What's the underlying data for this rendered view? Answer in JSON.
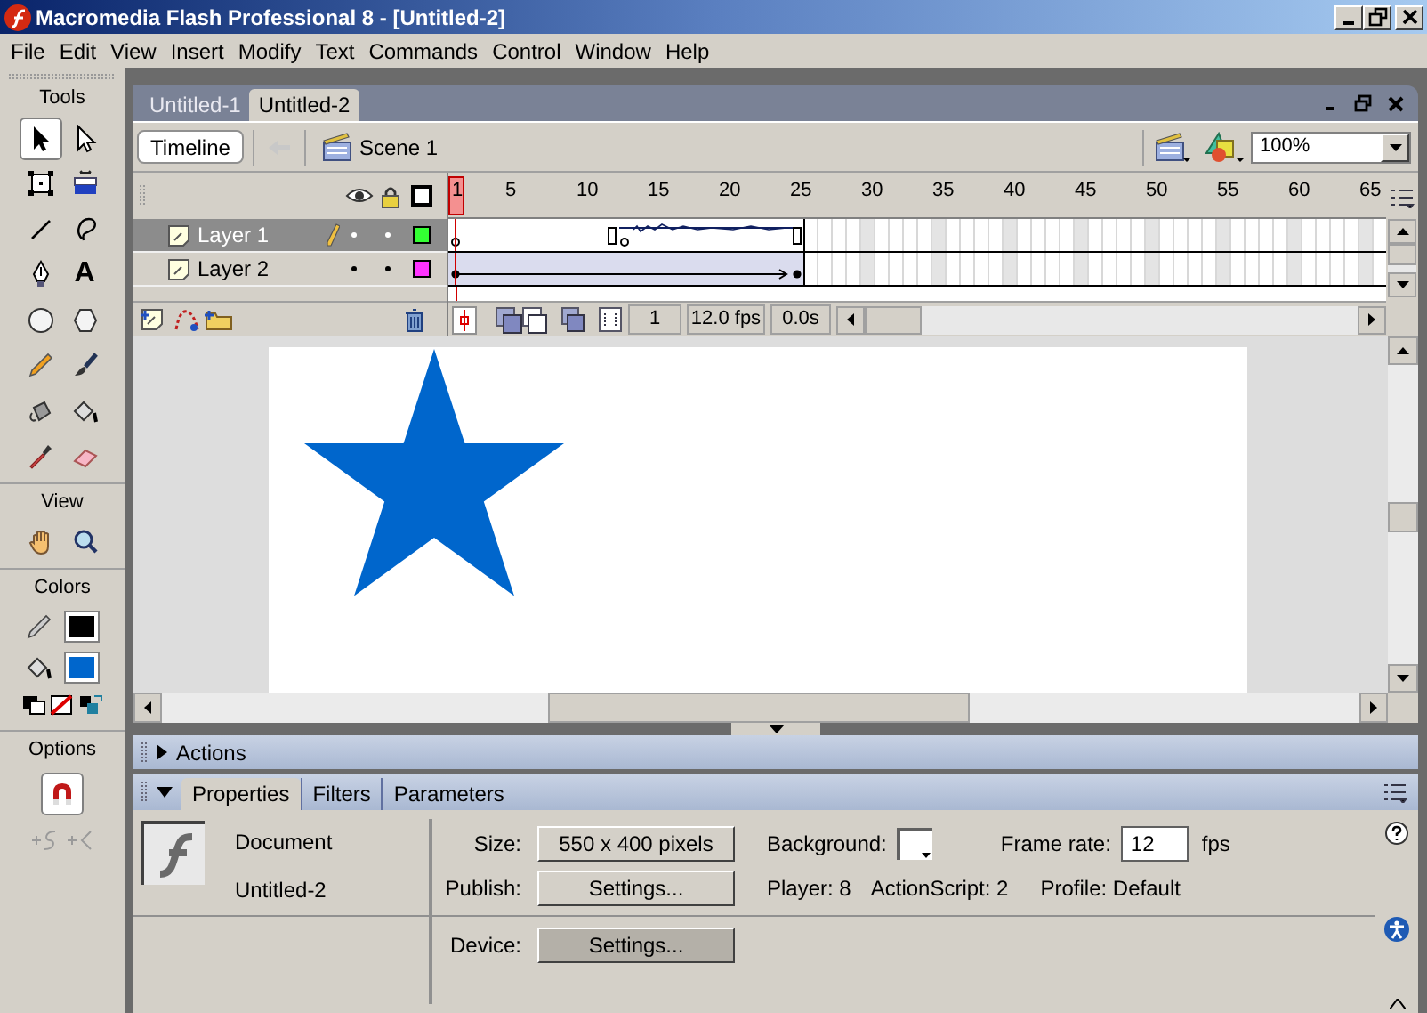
{
  "window": {
    "title": "Macromedia Flash Professional 8 - [Untitled-2]"
  },
  "menu": [
    "File",
    "Edit",
    "View",
    "Insert",
    "Modify",
    "Text",
    "Commands",
    "Control",
    "Window",
    "Help"
  ],
  "tools_panel": {
    "title": "Tools",
    "tools": [
      {
        "selected": true
      },
      {
        "selected": false
      },
      {
        "selected": false
      },
      {
        "selected": false
      },
      {
        "selected": false
      },
      {
        "selected": false
      },
      {
        "selected": false
      },
      {
        "selected": false,
        "glyph": "A"
      },
      {
        "selected": false
      },
      {
        "selected": false
      },
      {
        "selected": false
      },
      {
        "selected": false
      },
      {
        "selected": false
      },
      {
        "selected": false
      },
      {
        "selected": false
      },
      {
        "selected": false
      }
    ],
    "view_title": "View",
    "view_tools": [
      {
        "selected": false
      },
      {
        "selected": false
      }
    ],
    "colors_title": "Colors",
    "swatches": [
      {
        "kind": "stroke",
        "color": "#000000"
      },
      {
        "kind": "fill",
        "color": "#0066cc"
      }
    ],
    "options_title": "Options",
    "options": [
      {
        "kind": "toggle",
        "selected": true
      },
      {
        "kind": "action",
        "disabled": true
      },
      {
        "kind": "action",
        "disabled": true
      }
    ]
  },
  "document_tabs": [
    {
      "label": "Untitled-1",
      "selected": false
    },
    {
      "label": "Untitled-2",
      "selected": true
    }
  ],
  "edit_bar": {
    "timeline_button": "Timeline",
    "scene": "Scene 1",
    "zoom": "100%"
  },
  "timeline": {
    "ruler": [
      "1",
      "5",
      "10",
      "15",
      "20",
      "25",
      "30",
      "35",
      "40",
      "45",
      "50",
      "55",
      "60",
      "65"
    ],
    "layers": [
      {
        "name": "Layer 1",
        "selected": true,
        "editing": true,
        "color": "#33ff33",
        "kind": "sound"
      },
      {
        "name": "Layer 2",
        "selected": false,
        "editing": false,
        "color": "#ff33ff",
        "kind": "tween"
      }
    ],
    "current_frame": "1",
    "frame_rate": "12.0 fps",
    "elapsed": "0.0s"
  },
  "panels": {
    "actions": {
      "title": "Actions",
      "expanded": false
    },
    "properties": {
      "expanded": true,
      "tabs": [
        {
          "label": "Properties",
          "selected": true
        },
        {
          "label": "Filters",
          "selected": false
        },
        {
          "label": "Parameters",
          "selected": false
        }
      ],
      "document_type": "Document",
      "document_name": "Untitled-2",
      "size_label": "Size:",
      "size": "550 x 400 pixels",
      "background_label": "Background:",
      "frame_rate_label": "Frame rate:",
      "frame_rate": "12",
      "fps": "fps",
      "publish_label": "Publish:",
      "publish_button": "Settings...",
      "player": "Player: 8",
      "actionscript": "ActionScript: 2",
      "profile": "Profile: Default",
      "device_label": "Device:",
      "device_button": "Settings..."
    }
  }
}
